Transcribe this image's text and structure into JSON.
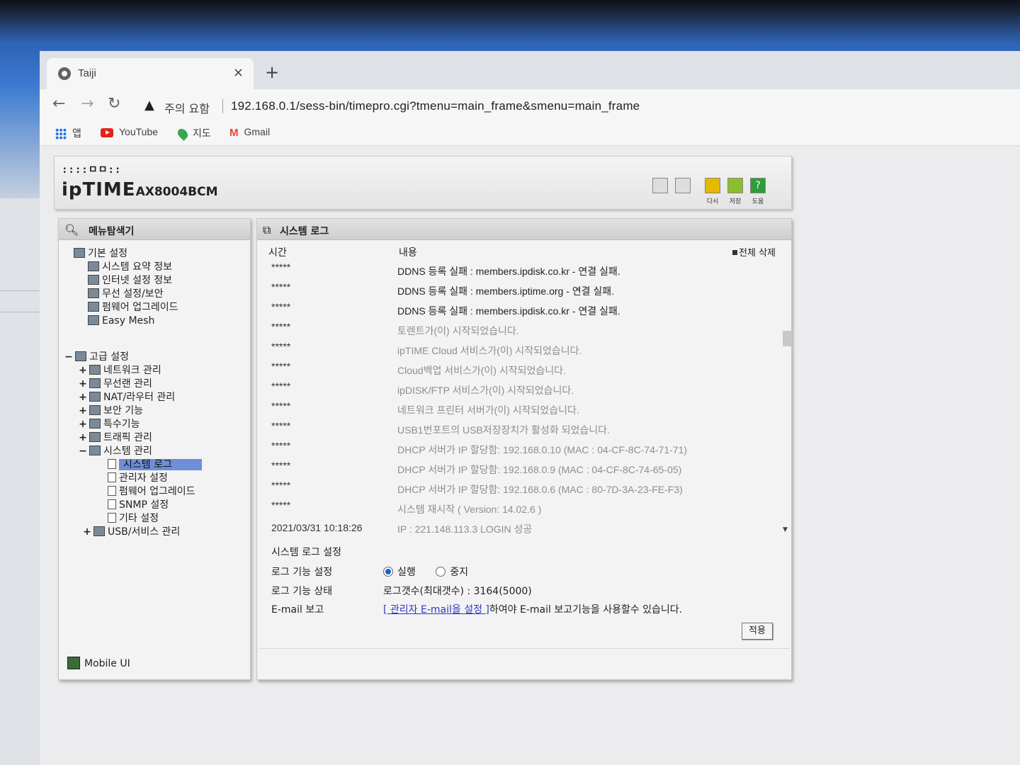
{
  "browser": {
    "tab_title": "Taiji",
    "tab_close": "×",
    "new_tab": "+",
    "security_label": "주의 요함",
    "url": "192.168.0.1/sess-bin/timepro.cgi?tmenu=main_frame&smenu=main_frame",
    "bookmarks": [
      {
        "label": "앱",
        "icon": "apps-icon"
      },
      {
        "label": "YouTube",
        "icon": "youtube-icon"
      },
      {
        "label": "지도",
        "icon": "maps-icon"
      },
      {
        "label": "Gmail",
        "icon": "gmail-icon"
      }
    ]
  },
  "router": {
    "logo_top": "::::ㅁㅁ::",
    "brand": "ipTIME",
    "model": "AX8004BCM",
    "header_buttons": [
      {
        "label": "다시",
        "icon": "refresh-icon",
        "color": "#e6b800"
      },
      {
        "label": "저장",
        "icon": "save-icon",
        "color": "#8bbf2a"
      },
      {
        "label": "도움",
        "icon": "help-icon",
        "color": "#2e9e3a"
      }
    ]
  },
  "sidebar": {
    "title": "메뉴탐색기",
    "basic": {
      "label": "기본 설정",
      "items": [
        "시스템 요약 정보",
        "인터넷 설정 정보",
        "무선 설정/보안",
        "펌웨어 업그레이드",
        "Easy Mesh"
      ]
    },
    "advanced": {
      "label": "고급 설정",
      "items": [
        "네트워크 관리",
        "무선랜 관리",
        "NAT/라우터 관리",
        "보안 기능",
        "특수기능",
        "트래픽 관리",
        "시스템 관리"
      ],
      "system_children": [
        "시스템 로그",
        "관리자 설정",
        "펌웨어 업그레이드",
        "SNMP 설정",
        "기타 설정"
      ],
      "last": "USB/서비스 관리"
    },
    "mobile": "Mobile UI"
  },
  "main": {
    "title": "시스템 로그",
    "col_time": "시간",
    "col_content": "내용",
    "delete_all": "전체 삭제",
    "logs": [
      {
        "time": "*****",
        "msg": "DDNS 등록 실패 : members.ipdisk.co.kr - 연결 실패.",
        "style": "dark"
      },
      {
        "time": "*****",
        "msg": "DDNS 등록 실패 : members.iptime.org - 연결 실패.",
        "style": "dark"
      },
      {
        "time": "*****",
        "msg": "DDNS 등록 실패 : members.ipdisk.co.kr - 연결 실패.",
        "style": "dark"
      },
      {
        "time": "*****",
        "msg": "토렌트가(이) 시작되었습니다.",
        "style": "grey"
      },
      {
        "time": "*****",
        "msg": "ipTIME Cloud 서비스가(이) 시작되었습니다.",
        "style": "grey"
      },
      {
        "time": "*****",
        "msg": "Cloud백업 서비스가(이) 시작되었습니다.",
        "style": "grey"
      },
      {
        "time": "*****",
        "msg": "ipDISK/FTP 서비스가(이) 시작되었습니다.",
        "style": "grey"
      },
      {
        "time": "*****",
        "msg": "네트워크 프린터 서버가(이) 시작되었습니다.",
        "style": "grey"
      },
      {
        "time": "*****",
        "msg": "USB1번포트의 USB저장장치가 활성화 되었습니다.",
        "style": "grey"
      },
      {
        "time": "*****",
        "msg": "DHCP 서버가 IP 할당함: 192.168.0.10 (MAC : 04-CF-8C-74-71-71)",
        "style": "grey"
      },
      {
        "time": "*****",
        "msg": "DHCP 서버가 IP 할당함: 192.168.0.9 (MAC : 04-CF-8C-74-65-05)",
        "style": "grey"
      },
      {
        "time": "*****",
        "msg": "DHCP 서버가 IP 할당함: 192.168.0.6 (MAC : 80-7D-3A-23-FE-F3)",
        "style": "grey"
      },
      {
        "time": "*****",
        "msg": "시스템 재시작 ( Version: 14.02.6 )",
        "style": "grey"
      },
      {
        "time": "2021/03/31 10:18:26",
        "msg": "IP : 221.148.113.3 LOGIN 성공",
        "style": "grey"
      }
    ],
    "settings": {
      "title": "시스템 로그 설정",
      "log_func_label": "로그 기능 설정",
      "run": "실행",
      "stop": "중지",
      "status_label": "로그 기능 상태",
      "status_value": "로그갯수(최대갯수) : 3164(5000)",
      "email_label": "E-mail 보고",
      "email_link": "[ 관리자 E-mail을 설정 ]",
      "email_rest": "하여야 E-mail 보고기능을 사용할수 있습니다.",
      "apply": "적용"
    }
  }
}
